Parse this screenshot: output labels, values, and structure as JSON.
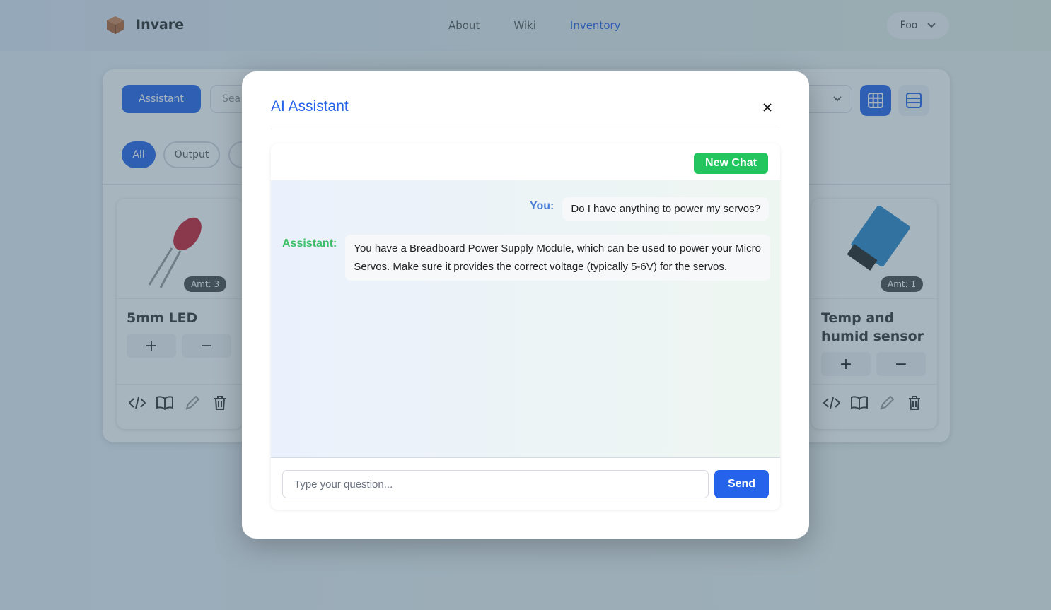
{
  "app": {
    "name": "Invare"
  },
  "nav": {
    "items": [
      "About",
      "Wiki",
      "Inventory"
    ],
    "active": "Inventory"
  },
  "user_menu": {
    "label": "Foo"
  },
  "toolbar": {
    "assistant_label": "Assistant",
    "search_placeholder": "Sea"
  },
  "filters": {
    "chips": [
      "All",
      "Output"
    ]
  },
  "cards": [
    {
      "name": "5mm LED",
      "qty_label": "Amt: 3"
    },
    {
      "name": "Temp and humid sensor",
      "qty_label": "Amt: 1"
    }
  ],
  "modal": {
    "title": "AI Assistant",
    "new_chat_label": "New Chat",
    "messages": [
      {
        "role_label": "You:",
        "text": "Do I have anything to power my servos?"
      },
      {
        "role_label": "Assistant:",
        "text": "You have a Breadboard Power Supply Module, which can be used to power your Micro Servos. Make sure it provides the correct voltage (typically 5-6V) for the servos."
      }
    ],
    "input": {
      "placeholder": "Type your question...",
      "value": ""
    },
    "send_label": "Send"
  },
  "colors": {
    "primary": "#2563eb",
    "success": "#22c55e",
    "you_label": "#4a7fd9",
    "assistant_label": "#3fbf6a"
  }
}
